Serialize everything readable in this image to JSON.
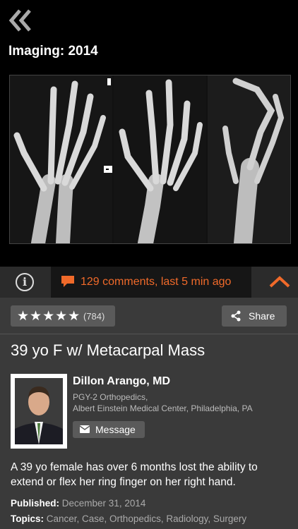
{
  "header": {
    "title": "Imaging: 2014",
    "back_icon": "double-chevron-left-icon"
  },
  "images": {
    "panels": [
      "xray-ap-view",
      "xray-oblique-view",
      "xray-lateral-view"
    ]
  },
  "toolbar": {
    "info_icon": "info-icon",
    "comments_text": "129 comments, last 5 min ago",
    "comment_icon": "speech-bubble-icon",
    "collapse_icon": "chevron-up-icon",
    "accent_color": "#f06a2a"
  },
  "actions": {
    "stars": "★★★★★",
    "rating_count": "(784)",
    "share_label": "Share"
  },
  "case": {
    "title": "39 yo F w/ Metacarpal Mass",
    "author_name": "Dillon Arango, MD",
    "author_role": "PGY-2 Orthopedics,",
    "author_institution": "Albert Einstein Medical Center, Philadelphia, PA",
    "message_label": "Message",
    "description": "A 39 yo female has over 6 months lost the ability to extend or flex her ring finger on her right hand.",
    "published_label": "Published:",
    "published_value": "December 31, 2014",
    "topics_label": "Topics:",
    "topics_value": "Cancer, Case, Orthopedics, Radiology, Surgery"
  }
}
